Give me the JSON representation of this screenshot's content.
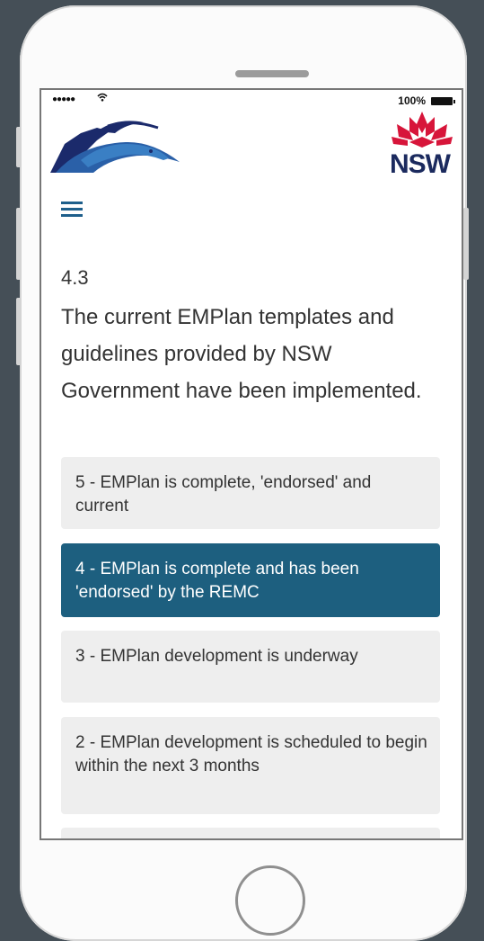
{
  "status_bar": {
    "signal": "●●●●●",
    "battery_percent": "100%"
  },
  "header": {
    "logo_text": "NSW"
  },
  "question": {
    "number": "4.3",
    "text": "The current EMPlan templates and guidelines provided by NSW Government have been implemented."
  },
  "options": [
    {
      "label": "5 - EMPlan is complete, 'endorsed' and current",
      "selected": false
    },
    {
      "label": "4 - EMPlan is complete and has been 'endorsed' by the REMC",
      "selected": true
    },
    {
      "label": "3 - EMPlan development is underway",
      "selected": false
    },
    {
      "label": "2 - EMPlan development is scheduled to begin within the next 3 months",
      "selected": false
    }
  ],
  "colors": {
    "background": "#454f57",
    "selected_option": "#1d5f7f",
    "option": "#eeeeee",
    "menu_icon": "#1e5f8b",
    "nsw_red": "#d7153a",
    "nsw_navy": "#1b2a5e"
  }
}
